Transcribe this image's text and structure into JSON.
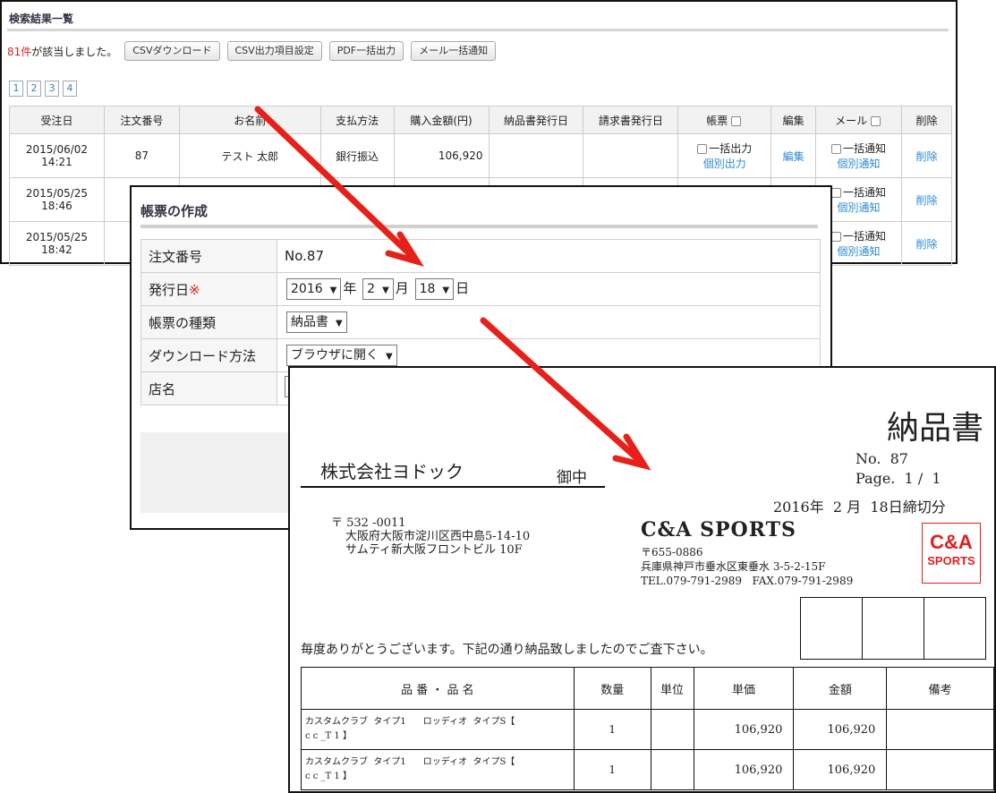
{
  "results": {
    "title": "検索結果一覧",
    "count": "81件",
    "count_suffix": "が該当しました。",
    "buttons": [
      "CSVダウンロード",
      "CSV出力項目設定",
      "PDF一括出力",
      "メール一括通知"
    ],
    "pages": [
      "1",
      "2",
      "3",
      "4"
    ],
    "headers": [
      "受注日",
      "注文番号",
      "お名前",
      "支払方法",
      "購入金額(円)",
      "納品書発行日",
      "請求書発行日",
      "帳票",
      "編集",
      "メール",
      "削除"
    ],
    "rows": [
      {
        "date": "2015/06/02",
        "time": "14:21",
        "order_no": "87",
        "name": "テスト 太郎",
        "payment": "銀行振込",
        "amount": "106,920",
        "slip_check": "一括出力",
        "slip_link": "個別出力",
        "edit": "編集",
        "mail_check": "一括通知",
        "mail_link": "個別通知",
        "delete": "削除"
      },
      {
        "date": "2015/05/25",
        "time": "18:46",
        "mail_check": "一括通知",
        "mail_link": "個別通知",
        "delete": "削除"
      },
      {
        "date": "2015/05/25",
        "time": "18:42",
        "mail_check": "一括通知",
        "mail_link": "個別通知",
        "delete": "削除"
      }
    ]
  },
  "form": {
    "title": "帳票の作成",
    "order_label": "注文番号",
    "order_value": "No.87",
    "issue_label": "発行日",
    "required_mark": "※",
    "year": "2016",
    "year_unit": "年",
    "month": "2",
    "month_unit": "月",
    "day": "18",
    "day_unit": "日",
    "type_label": "帳票の種類",
    "type_value": "納品書",
    "download_label": "ダウンロード方法",
    "download_value": "ブラウザに開く",
    "shop_label": "店名"
  },
  "slip": {
    "title": "納品書",
    "doc_no": "No.  87",
    "page": "Page.  1 /  1",
    "deadline": "2016年  2 月  18日締切分",
    "customer": "株式会社ヨドック",
    "honorific": "御中",
    "cust_zip": "〒 532 -0011",
    "cust_addr1": "大阪府大阪市淀川区西中島5-14-10",
    "cust_addr2": "サムティ新大阪フロントビル 10F",
    "company": "C&A SPORTS",
    "co_zip": "〒655-0886",
    "co_addr": "兵庫県神戸市垂水区東垂水 3-5-2-15F",
    "co_tel": "TEL.079-791-2989   FAX.079-791-2989",
    "logo_line1": "C&A",
    "logo_line2": "SPORTS",
    "greeting": "毎度ありがとうございます。下記の通り納品致しましたのでご査下さい。",
    "headers": [
      "品 番 ・ 品 名",
      "数量",
      "単位",
      "単価",
      "金額",
      "備考"
    ],
    "rows": [
      {
        "item1": "カスタムクラブ  タイプ1      ロッディオ  タイプS【",
        "item2": "c c _T 1 】",
        "qty": "1",
        "unit": "",
        "price": "106,920",
        "amount": "106,920",
        "note": ""
      },
      {
        "item1": "カスタムクラブ  タイプ1      ロッディオ  タイプS【",
        "item2": "c c _T 1 】",
        "qty": "1",
        "unit": "",
        "price": "106,920",
        "amount": "106,920",
        "note": ""
      }
    ]
  },
  "colors": {
    "arrow": "#e8201a",
    "accent_link": "#2a8ad4",
    "count_red": "#e02020"
  }
}
